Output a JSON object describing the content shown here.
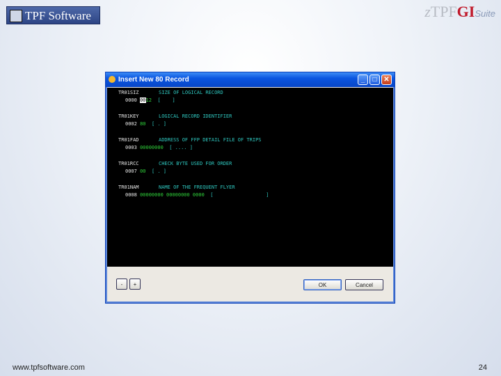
{
  "header": {
    "logo": "TPF Software",
    "brand_z": "z",
    "brand_tpf": "TPF",
    "brand_gi": "GI",
    "brand_suite": "Suite"
  },
  "dialog": {
    "title": "Insert New 80 Record",
    "minimize": "_",
    "maximize": "□",
    "close": "✕",
    "fields": [
      {
        "name": "TR01SIZ",
        "desc": "SIZE OF LOGICAL RECORD",
        "offset": "0000",
        "value_cursor": "00",
        "value_rest": "12",
        "bracket": "[    ]"
      },
      {
        "name": "TR01KEY",
        "desc": "LOGICAL RECORD IDENTIFIER",
        "offset": "0002",
        "value_cursor": "",
        "value_rest": "80",
        "bracket": "[ . ]"
      },
      {
        "name": "TR01FAD",
        "desc": "ADDRESS OF FFP DETAIL FILE OF TRIPS",
        "offset": "0003",
        "value_cursor": "",
        "value_rest": "00000000",
        "bracket": "[ .... ]"
      },
      {
        "name": "TR01RCC",
        "desc": "CHECK BYTE USED FOR ORDER",
        "offset": "0007",
        "value_cursor": "",
        "value_rest": "00",
        "bracket": "[ . ]"
      },
      {
        "name": "TR01NAM",
        "desc": "NAME OF THE FREQUENT FLYER",
        "offset": "0008",
        "value_cursor": "",
        "value_rest": "00000000 00000000 0000",
        "bracket": "[                  ]"
      }
    ],
    "minus": "-",
    "plus": "+",
    "ok": "OK",
    "cancel": "Cancel"
  },
  "footer": {
    "url": "www.tpfsoftware.com",
    "page": "24"
  }
}
